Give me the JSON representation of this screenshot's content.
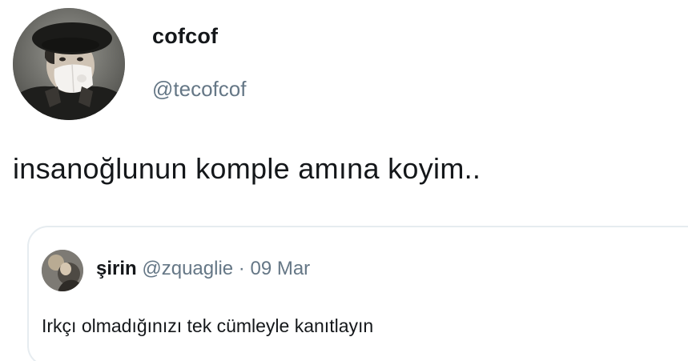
{
  "tweet": {
    "display_name": "cofcof",
    "handle": "@tecofcof",
    "text": "insanoğlunun komple amına koyim.."
  },
  "quoted_tweet": {
    "display_name": "şirin",
    "handle": "@zquaglie",
    "separator": "·",
    "date": "09 Mar",
    "text": "Irkçı olmadığınızı tek cümleyle kanıtlayın"
  },
  "colors": {
    "text_primary": "#14171a",
    "text_secondary": "#657786",
    "border": "#e6ecf0"
  },
  "icons": {
    "main_avatar": "user-avatar-photo",
    "quote_avatar": "user-avatar-photo"
  }
}
